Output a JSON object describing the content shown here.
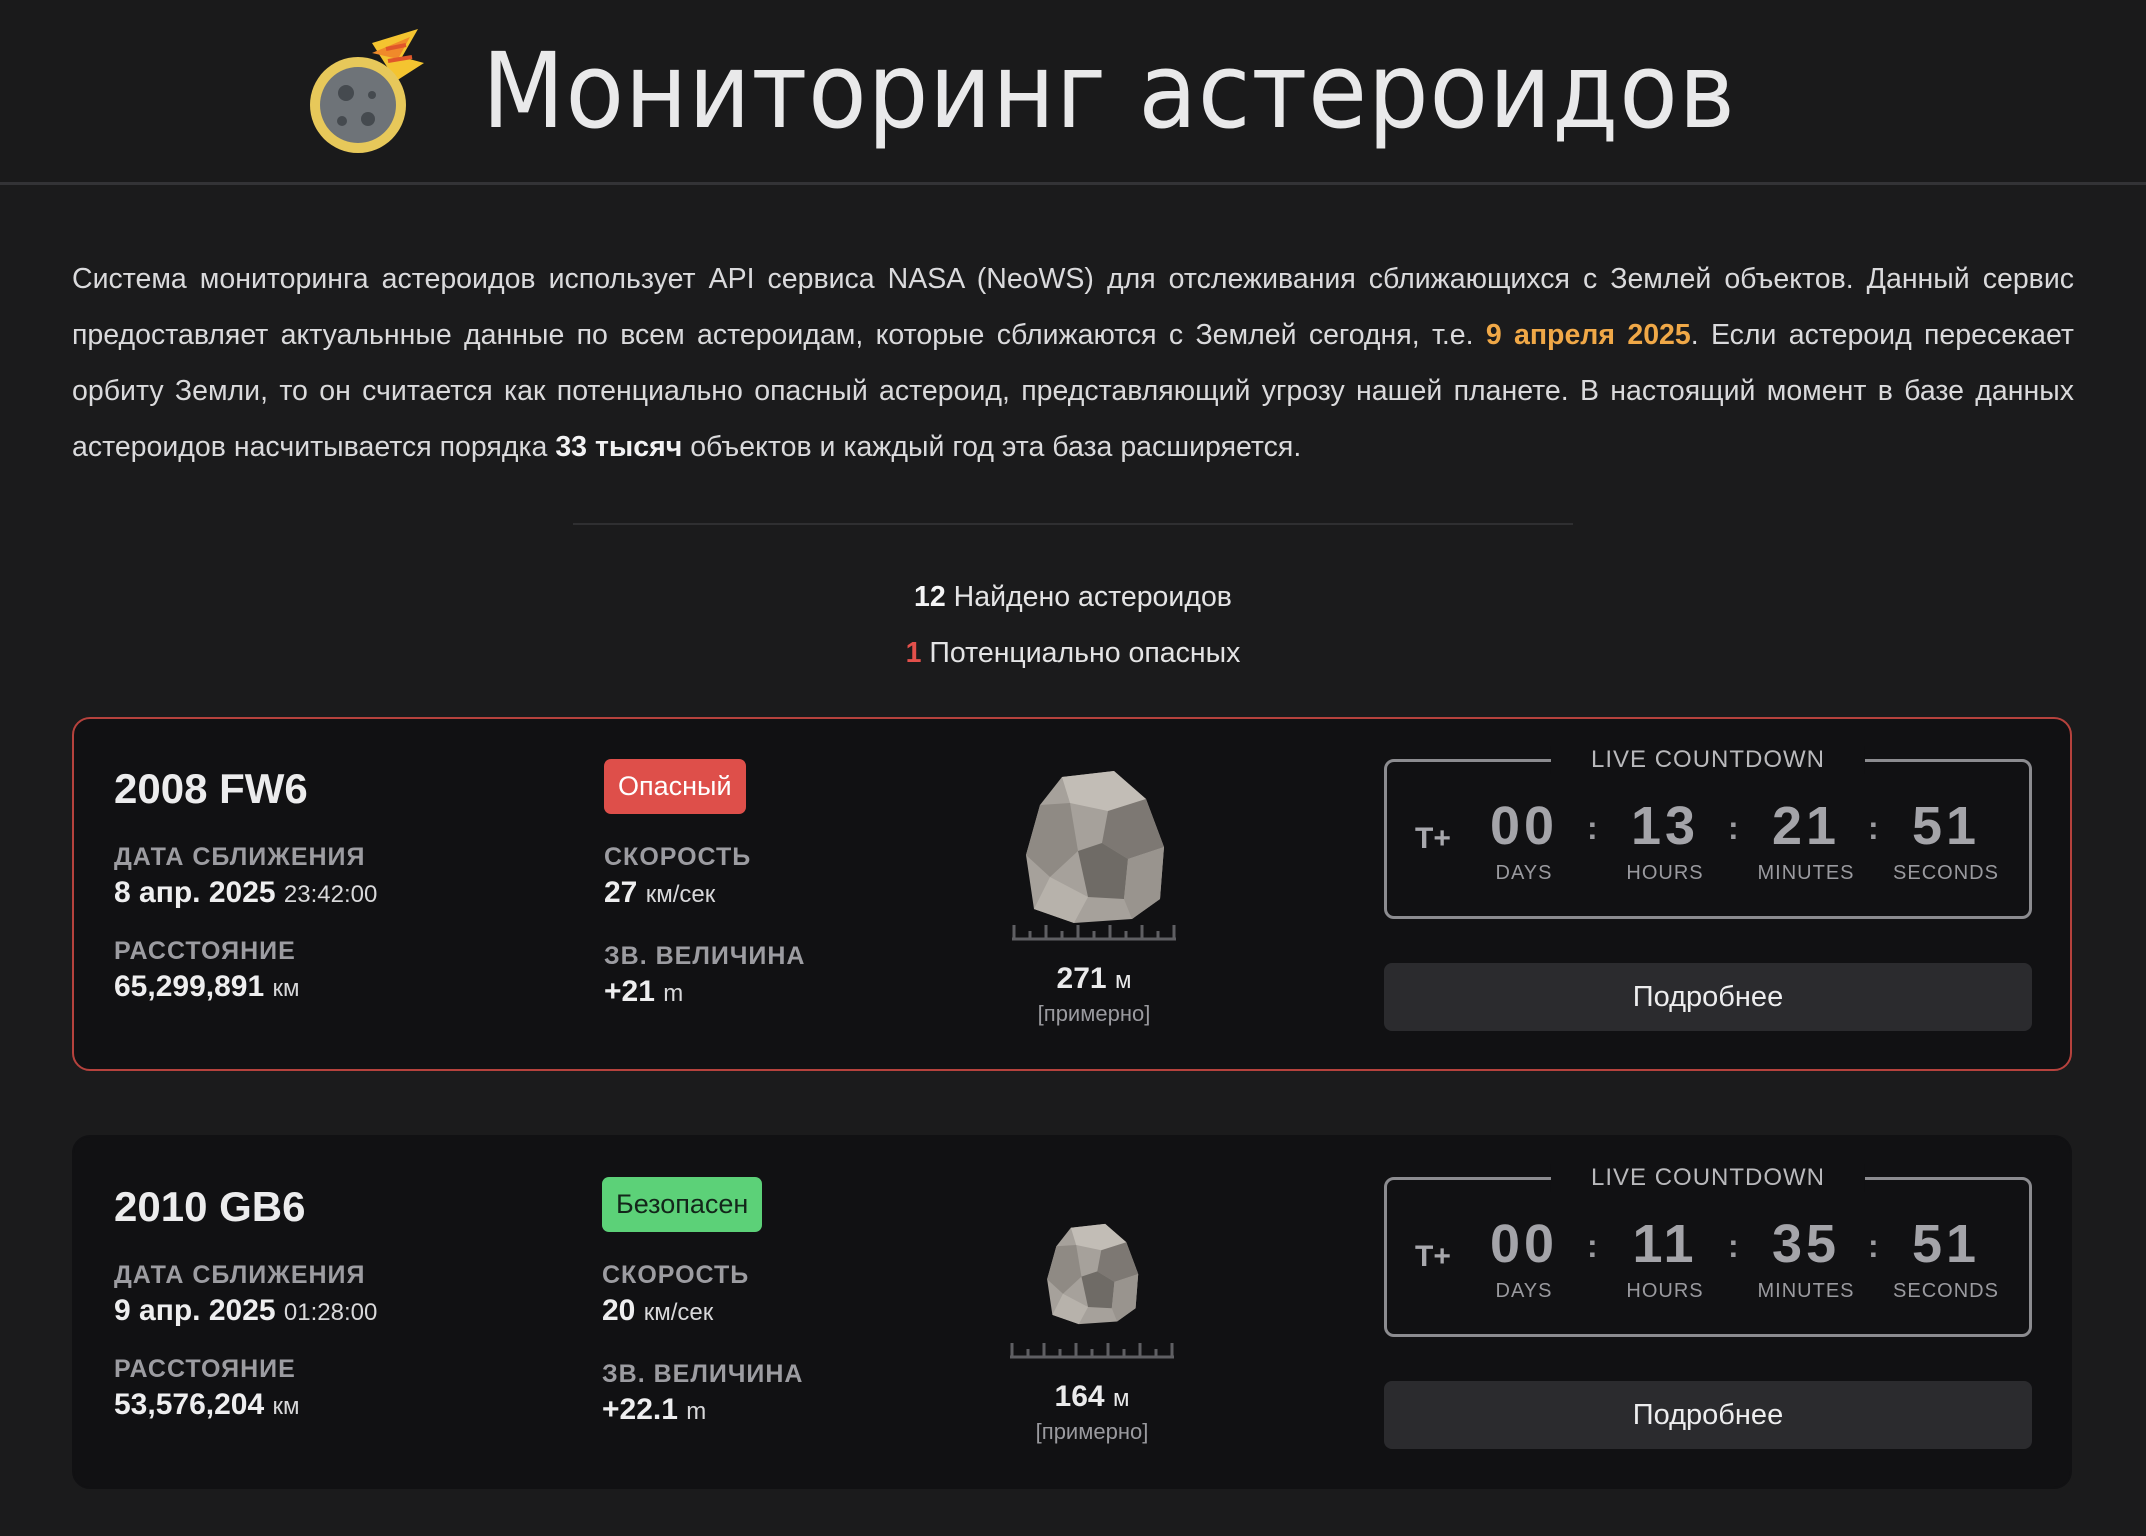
{
  "header": {
    "title": "Мониторинг астероидов",
    "logo_icon": "comet-icon"
  },
  "intro": {
    "part1": "Система мониторинга астероидов использует API сервиса NASA (NeoWS) для отслеживания сближающихся с Землей объектов. Данный сервис предоставляет актуальнные данные по всем астероидам, которые сближаются с Землей сегодня, т.е. ",
    "date": "9 апреля 2025",
    "part2": ". Если астероид пересекает орбиту Земли, то он считается как потенциально опасный астероид, представляющий угрозу нашей планете. В настоящий момент в базе данных астероидов насчитывается порядка ",
    "count": "33 тысяч",
    "part3": " объектов и каждый год эта база расширяется."
  },
  "stats": {
    "found_count": "12",
    "found_label": "Найдено астероидов",
    "hazard_count": "1",
    "hazard_label": "Потенциально опасных"
  },
  "colors": {
    "danger": "#de4f4a",
    "safe": "#5cd178",
    "accent_date": "#f0a847"
  },
  "asteroids": [
    {
      "name": "2008 FW6",
      "status": "Опасный",
      "date_label": "ДАТА СБЛИЖЕНИЯ",
      "date": "8 апр. 2025",
      "time": "23:42:00",
      "distance_label": "РАССТОЯНИЕ",
      "distance": "65,299,891",
      "distance_unit": "км",
      "speed_label": "СКОРОСТЬ",
      "speed": "27",
      "speed_unit": "км/сек",
      "mag_label": "ЗВ. ВЕЛИЧИНА",
      "mag": "+21",
      "mag_unit": "m",
      "size": "271",
      "size_unit": "м",
      "size_note": "[примерно]",
      "countdown": {
        "title": "LIVE COUNTDOWN",
        "prefix": "T+",
        "days": "00",
        "hours": "13",
        "minutes": "21",
        "seconds": "51",
        "days_label": "DAYS",
        "hours_label": "HOURS",
        "minutes_label": "MINUTES",
        "seconds_label": "SECONDS"
      },
      "more_label": "Подробнее"
    },
    {
      "name": "2010 GB6",
      "status": "Безопасен",
      "date_label": "ДАТА СБЛИЖЕНИЯ",
      "date": "9 апр. 2025",
      "time": "01:28:00",
      "distance_label": "РАССТОЯНИЕ",
      "distance": "53,576,204",
      "distance_unit": "км",
      "speed_label": "СКОРОСТЬ",
      "speed": "20",
      "speed_unit": "км/сек",
      "mag_label": "ЗВ. ВЕЛИЧИНА",
      "mag": "+22.1",
      "mag_unit": "m",
      "size": "164",
      "size_unit": "м",
      "size_note": "[примерно]",
      "countdown": {
        "title": "LIVE COUNTDOWN",
        "prefix": "T+",
        "days": "00",
        "hours": "11",
        "minutes": "35",
        "seconds": "51",
        "days_label": "DAYS",
        "hours_label": "HOURS",
        "minutes_label": "MINUTES",
        "seconds_label": "SECONDS"
      },
      "more_label": "Подробнее"
    }
  ]
}
